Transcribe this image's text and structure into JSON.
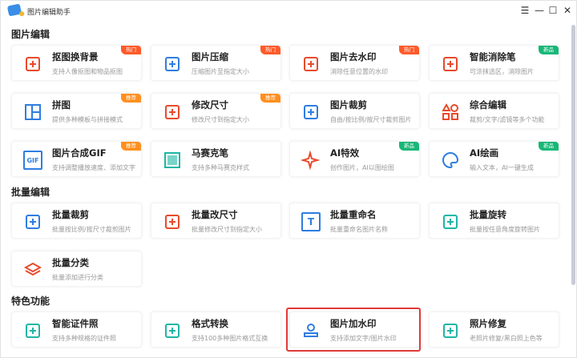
{
  "app": {
    "title": "图片编辑助手"
  },
  "sections": [
    {
      "title": "图片编辑",
      "cards": [
        {
          "title": "抠图换背景",
          "desc": "支持人像抠图和物品抠图",
          "badge": "热门",
          "badge_type": "hot",
          "icon": "cutout-icon",
          "color": "#e84a2c"
        },
        {
          "title": "图片压缩",
          "desc": "压缩图片至指定大小",
          "badge": "热门",
          "badge_type": "hot",
          "icon": "compress-icon",
          "color": "#2f7de1"
        },
        {
          "title": "图片去水印",
          "desc": "消除任意位置的水印",
          "badge": "热门",
          "badge_type": "hot",
          "icon": "remove-watermark-icon",
          "color": "#e84a2c"
        },
        {
          "title": "智能消除笔",
          "desc": "可涂抹选区，消除图片",
          "badge": "新品",
          "badge_type": "new",
          "icon": "eraser-icon",
          "color": "#e84a2c"
        },
        {
          "title": "拼图",
          "desc": "提供多种模板与拼接模式",
          "badge": "推荐",
          "badge_type": "rec",
          "icon": "collage-icon",
          "color": "#2f7de1"
        },
        {
          "title": "修改尺寸",
          "desc": "修改尺寸到指定大小",
          "badge": "推荐",
          "badge_type": "rec",
          "icon": "resize-icon",
          "color": "#e84a2c"
        },
        {
          "title": "图片裁剪",
          "desc": "自由/按比例/按尺寸裁剪图片",
          "badge": "",
          "badge_type": "",
          "icon": "crop-icon",
          "color": "#2f7de1"
        },
        {
          "title": "综合编辑",
          "desc": "裁剪/文字/滤镜等多个功能",
          "badge": "",
          "badge_type": "",
          "icon": "shapes-icon",
          "color": "#e84a2c"
        },
        {
          "title": "图片合成GIF",
          "desc": "支持调整播放速度、添加文字",
          "badge": "推荐",
          "badge_type": "rec",
          "icon": "gif-icon",
          "color": "#2f7de1",
          "icon_text": "GIF"
        },
        {
          "title": "马赛克笔",
          "desc": "支持多种马赛克样式",
          "badge": "",
          "badge_type": "",
          "icon": "mosaic-icon",
          "color": "#1fb5a5"
        },
        {
          "title": "AI特效",
          "desc": "创作图片，AI以图绘图",
          "badge": "新品",
          "badge_type": "new",
          "icon": "sparkle-icon",
          "color": "#e84a2c"
        },
        {
          "title": "AI绘画",
          "desc": "输入文本，AI一键生成",
          "badge": "新品",
          "badge_type": "new",
          "icon": "palette-icon",
          "color": "#2f7de1"
        }
      ]
    },
    {
      "title": "批量编辑",
      "cards": [
        {
          "title": "批量裁剪",
          "desc": "批量按比例/按尺寸裁剪图片",
          "badge": "",
          "badge_type": "",
          "icon": "batch-crop-icon",
          "color": "#2f7de1"
        },
        {
          "title": "批量改尺寸",
          "desc": "批量修改尺寸到指定大小",
          "badge": "",
          "badge_type": "",
          "icon": "batch-resize-icon",
          "color": "#e84a2c"
        },
        {
          "title": "批量重命名",
          "desc": "批量重命名图片名称",
          "badge": "",
          "badge_type": "",
          "icon": "batch-rename-icon",
          "color": "#2f7de1",
          "icon_text": "T"
        },
        {
          "title": "批量旋转",
          "desc": "批量按任意角度旋转图片",
          "badge": "",
          "badge_type": "",
          "icon": "batch-rotate-icon",
          "color": "#1fb5a5"
        },
        {
          "title": "批量分类",
          "desc": "批量添加进行分类",
          "badge": "",
          "badge_type": "",
          "icon": "layers-icon",
          "color": "#e84a2c"
        }
      ]
    },
    {
      "title": "特色功能",
      "cards": [
        {
          "title": "智能证件照",
          "desc": "支持多种规格的证件照",
          "badge": "",
          "badge_type": "",
          "icon": "id-photo-icon",
          "color": "#1fb5a5"
        },
        {
          "title": "格式转换",
          "desc": "支持100多种图片格式互换",
          "badge": "",
          "badge_type": "",
          "icon": "convert-icon",
          "color": "#1fb5a5"
        },
        {
          "title": "图片加水印",
          "desc": "支持添加文字/图片水印",
          "badge": "",
          "badge_type": "",
          "icon": "stamp-icon",
          "color": "#2f7de1"
        },
        {
          "title": "照片修复",
          "desc": "老照片修复/黑白照上色等",
          "badge": "",
          "badge_type": "",
          "icon": "magic-wand-icon",
          "color": "#1fb5a5"
        }
      ]
    }
  ]
}
